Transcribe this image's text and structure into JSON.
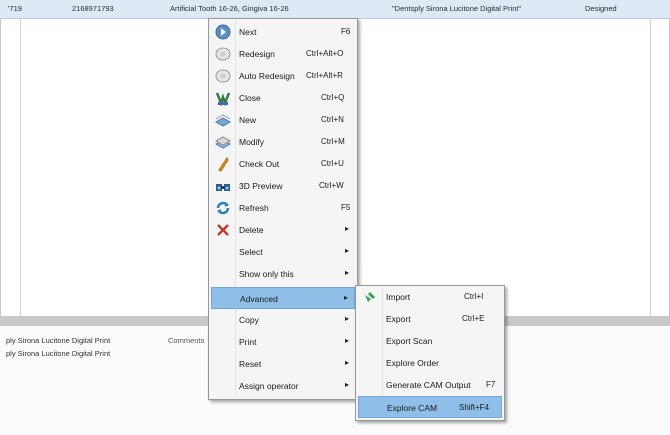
{
  "top_row": {
    "col1": "'719",
    "col2": "2168971793",
    "col3": "Artificial Tooth 16-26, Gingiva 16-26",
    "col4": "\"Dentsply Sirona Lucitone Digital Print\"",
    "col5": "Designed"
  },
  "lower_panel": {
    "line1": "ply Sirona Lucitone Digital Print",
    "line2": "ply Sirona Lucitone Digital Print",
    "comments": "Comments"
  },
  "context_menu": {
    "items": [
      {
        "label": "Next",
        "shortcut": "F6",
        "icon": "next-arrow-icon"
      },
      {
        "label": "Redesign",
        "shortcut": "Ctrl+Alt+O",
        "icon": "redesign-icon"
      },
      {
        "label": "Auto Redesign",
        "shortcut": "Ctrl+Alt+R",
        "icon": "auto-redesign-icon"
      },
      {
        "label": "Close",
        "shortcut": "Ctrl+Q",
        "icon": "close-order-icon"
      },
      {
        "label": "New",
        "shortcut": "Ctrl+N",
        "icon": "new-icon"
      },
      {
        "label": "Modify",
        "shortcut": "Ctrl+M",
        "icon": "modify-icon"
      },
      {
        "label": "Check Out",
        "shortcut": "Ctrl+U",
        "icon": "check-out-icon"
      },
      {
        "label": "3D Preview",
        "shortcut": "Ctrl+W",
        "icon": "preview-3d-icon"
      },
      {
        "label": "Refresh",
        "shortcut": "F5",
        "icon": "refresh-icon"
      },
      {
        "label": "Delete",
        "shortcut": "",
        "icon": "delete-icon",
        "submenu": true
      },
      {
        "label": "Select",
        "shortcut": "",
        "submenu": true
      },
      {
        "label": "Show only this",
        "shortcut": "",
        "submenu": true
      },
      {
        "label": "Advanced",
        "shortcut": "",
        "submenu": true,
        "highlighted": true
      },
      {
        "label": "Copy",
        "shortcut": "",
        "submenu": true
      },
      {
        "label": "Print",
        "shortcut": "",
        "submenu": true
      },
      {
        "label": "Reset",
        "shortcut": "",
        "submenu": true
      },
      {
        "label": "Assign operator",
        "shortcut": "",
        "submenu": true
      }
    ]
  },
  "submenu": {
    "items": [
      {
        "label": "Import",
        "shortcut": "Ctrl+I",
        "icon": "import-icon"
      },
      {
        "label": "Export",
        "shortcut": "Ctrl+E"
      },
      {
        "label": "Export Scan",
        "shortcut": ""
      },
      {
        "label": "Explore Order",
        "shortcut": ""
      },
      {
        "label": "Generate CAM Output",
        "shortcut": "F7"
      },
      {
        "label": "Explore CAM",
        "shortcut": "Shift+F4",
        "highlighted": true
      }
    ]
  },
  "colors": {
    "highlight": "#8fbfe8",
    "menu_bg": "#f5f5f5",
    "row_bg": "#dfe9f5",
    "delete_red": "#c0392b"
  }
}
